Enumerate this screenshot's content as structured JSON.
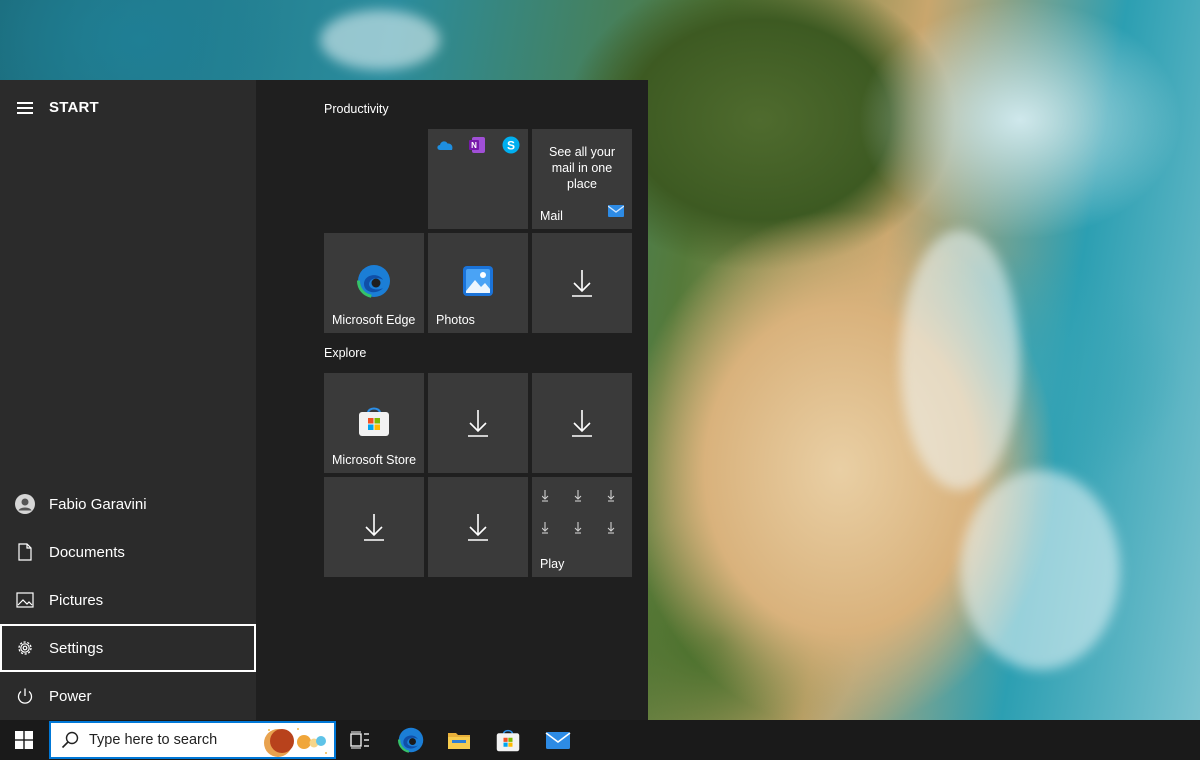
{
  "start_menu": {
    "title": "START",
    "nav": {
      "user": "Fabio Garavini",
      "documents": "Documents",
      "pictures": "Pictures",
      "settings": "Settings",
      "power": "Power"
    },
    "groups": {
      "productivity": "Productivity",
      "explore": "Explore"
    },
    "tiles": {
      "mail_promo": "See all your mail in one place",
      "mail_label": "Mail",
      "edge_label": "Microsoft Edge",
      "photos_label": "Photos",
      "store_label": "Microsoft Store",
      "play_label": "Play"
    }
  },
  "taskbar": {
    "search_placeholder": "Type here to search",
    "pinned": [
      "task-view",
      "microsoft-edge",
      "file-explorer",
      "microsoft-store",
      "mail"
    ]
  },
  "colors": {
    "accent": "#0078d7",
    "start_left_bg": "#2b2b2b",
    "start_right_bg": "#1f1f1f",
    "tile_bg": "#3a3a3a",
    "taskbar_bg": "#1a1a1a"
  }
}
